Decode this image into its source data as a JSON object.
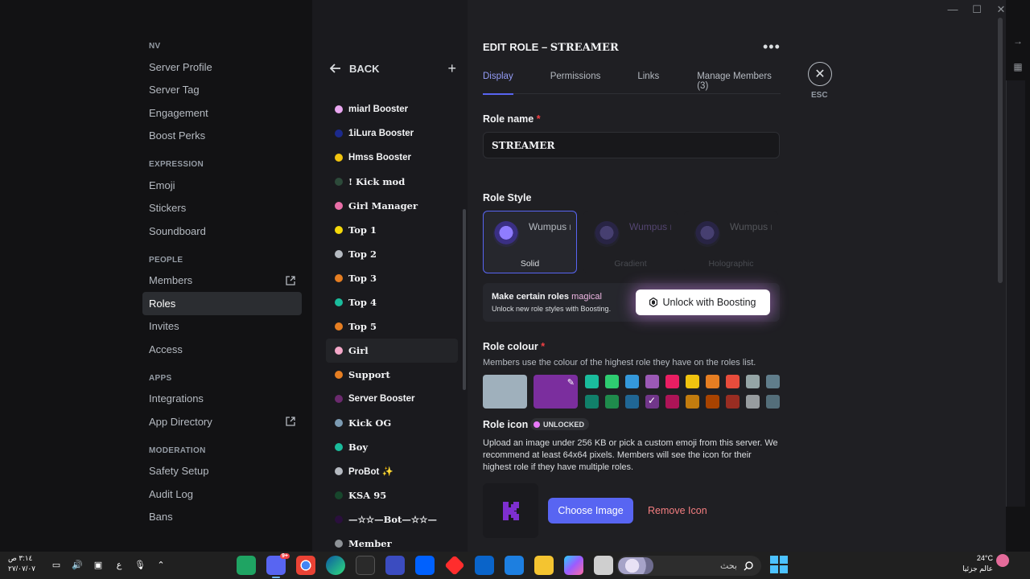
{
  "settings_nav": {
    "sections": [
      {
        "title": "NV",
        "items": [
          "Server Profile",
          "Server Tag",
          "Engagement",
          "Boost Perks"
        ]
      },
      {
        "title": "EXPRESSION",
        "items": [
          "Emoji",
          "Stickers",
          "Soundboard"
        ]
      },
      {
        "title": "PEOPLE",
        "items": [
          "Members",
          "Roles",
          "Invites",
          "Access"
        ]
      },
      {
        "title": "APPS",
        "items": [
          "Integrations",
          "App Directory"
        ]
      },
      {
        "title": "MODERATION",
        "items": [
          "Safety Setup",
          "Audit Log",
          "Bans"
        ]
      }
    ],
    "active_item": "Roles"
  },
  "roles_panel": {
    "back_label": "BACK",
    "add_label": "+",
    "roles": [
      {
        "name": "miarl Booster",
        "color": "#e9a7f0"
      },
      {
        "name": "1iLura Booster",
        "color": "#1c2a8c"
      },
      {
        "name": "Hmss Booster",
        "color": "#f1c40f"
      },
      {
        "name": "! Kick mod",
        "color": "#2d4a3a"
      },
      {
        "name": "Girl Manager",
        "color": "#e86ea7"
      },
      {
        "name": "Top 1",
        "color": "#f5d90a"
      },
      {
        "name": "Top 2",
        "color": "#b5bac1"
      },
      {
        "name": "Top 3",
        "color": "#e67e22"
      },
      {
        "name": "Top 4",
        "color": "#1abc9c"
      },
      {
        "name": "Top 5",
        "color": "#e67e22"
      },
      {
        "name": "Girl",
        "color": "#f4a8c9"
      },
      {
        "name": "Support",
        "color": "#e67e22"
      },
      {
        "name": "Server Booster",
        "color": "#6b2a6e"
      },
      {
        "name": "Kick OG",
        "color": "#7c9bb3"
      },
      {
        "name": "Boy",
        "color": "#1abc9c"
      },
      {
        "name": "ProBot ✨",
        "color": "#b5bac1"
      },
      {
        "name": "KSA 95",
        "color": "#17462c"
      },
      {
        "name": "—☆☆—Bot—☆☆—",
        "color": "#2a0f3d"
      },
      {
        "name": "Member",
        "color": "#8e9297"
      }
    ]
  },
  "edit_role": {
    "title_prefix": "EDIT ROLE – ",
    "role_name": "STREAMER",
    "more_label": "•••",
    "tabs": [
      "Display",
      "Permissions",
      "Links",
      "Manage Members (3)"
    ],
    "active_tab": "Display",
    "esc_label": "ESC",
    "role_name_label": "Role name",
    "required_mark": "*",
    "role_name_value": "STREAMER",
    "role_style_label": "Role Style",
    "styles": [
      {
        "label": "Solid",
        "preview": "Wumpus rocks a"
      },
      {
        "label": "Gradient",
        "preview": "Wumpus rocks a"
      },
      {
        "label": "Holographic",
        "preview": "Wumpus rocks a"
      }
    ],
    "boost_banner": {
      "title_prefix": "Make certain roles ",
      "title_magic": "magical",
      "subtitle": "Unlock new role styles with Boosting.",
      "button_label": "Unlock with Boosting"
    },
    "role_colour_label": "Role colour",
    "role_colour_desc": "Members use the colour of the highest role they have on the roles list.",
    "default_colour": "#9fb0bc",
    "custom_colour": "#7b2e9e",
    "swatches": [
      "#1abc9c",
      "#2ecc71",
      "#3498db",
      "#9b59b6",
      "#e91e63",
      "#f1c40f",
      "#e67e22",
      "#e74c3c",
      "#95a5a6",
      "#607d8b",
      "#11806a",
      "#1f8b4c",
      "#206694",
      "#71368a",
      "#ad1457",
      "#c27c0e",
      "#a84300",
      "#992d22",
      "#979c9f",
      "#546e7a"
    ],
    "selected_swatch_index": 13,
    "role_icon_label": "Role icon",
    "unlocked_label": "UNLOCKED",
    "icon_desc": "Upload an image under 256 KB or pick a custom emoji from this server. We recommend at least 64x64 pixels. Members will see the icon for their highest role if they have multiple roles.",
    "choose_image_label": "Choose Image",
    "remove_icon_label": "Remove Icon"
  },
  "taskbar": {
    "clock_time": "٣:١٤ ص",
    "clock_date": "٢٧/٠٧/٠٧",
    "lang": "ع",
    "search_placeholder": "بحث",
    "weather_temp": "24°C",
    "weather_desc": "عالم جزئيا",
    "discord_badge": "9+"
  }
}
